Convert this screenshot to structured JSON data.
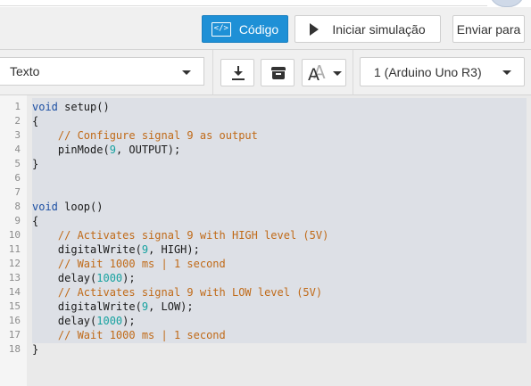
{
  "toolbar": {
    "code_label": "Código",
    "simulate_label": "Iniciar simulação",
    "send_label": "Enviar para"
  },
  "editor_toolbar": {
    "mode_value": "Texto",
    "board_value": "1 (Arduino Uno R3)"
  },
  "icons": {
    "code": "code-icon",
    "play": "play-icon",
    "download": "download-icon",
    "library": "library-box-icon",
    "font": "font-size-icon"
  },
  "colors": {
    "accent": "#1e90d6",
    "keyword": "#1c4fa3",
    "comment": "#c06a18",
    "number": "#17a2a0"
  },
  "code": {
    "line_numbers": [
      "1",
      "2",
      "3",
      "4",
      "5",
      "6",
      "7",
      "8",
      "9",
      "10",
      "11",
      "12",
      "13",
      "14",
      "15",
      "16",
      "17",
      "18"
    ],
    "lines": [
      [
        {
          "t": "void",
          "c": "kw"
        },
        {
          "t": " setup()",
          "c": "fn"
        }
      ],
      [
        {
          "t": "{",
          "c": "fn"
        }
      ],
      [
        {
          "t": "    // Configure signal 9 as output",
          "c": "cm"
        }
      ],
      [
        {
          "t": "    pinMode(",
          "c": "fn"
        },
        {
          "t": "9",
          "c": "num"
        },
        {
          "t": ", OUTPUT);",
          "c": "fn"
        }
      ],
      [
        {
          "t": "}",
          "c": "fn"
        }
      ],
      [],
      [],
      [
        {
          "t": "void",
          "c": "kw"
        },
        {
          "t": " loop()",
          "c": "fn"
        }
      ],
      [
        {
          "t": "{",
          "c": "fn"
        }
      ],
      [
        {
          "t": "    // Activates signal 9 with HIGH level (5V)",
          "c": "cm"
        }
      ],
      [
        {
          "t": "    digitalWrite(",
          "c": "fn"
        },
        {
          "t": "9",
          "c": "num"
        },
        {
          "t": ", HIGH);",
          "c": "fn"
        }
      ],
      [
        {
          "t": "    // Wait 1000 ms | 1 second",
          "c": "cm"
        }
      ],
      [
        {
          "t": "    delay(",
          "c": "fn"
        },
        {
          "t": "1000",
          "c": "num"
        },
        {
          "t": ");",
          "c": "fn"
        }
      ],
      [
        {
          "t": "    // Activates signal 9 with LOW level (5V)",
          "c": "cm"
        }
      ],
      [
        {
          "t": "    digitalWrite(",
          "c": "fn"
        },
        {
          "t": "9",
          "c": "num"
        },
        {
          "t": ", LOW);",
          "c": "fn"
        }
      ],
      [
        {
          "t": "    delay(",
          "c": "fn"
        },
        {
          "t": "1000",
          "c": "num"
        },
        {
          "t": ");",
          "c": "fn"
        }
      ],
      [
        {
          "t": "    // Wait 1000 ms | 1 second",
          "c": "cm"
        }
      ],
      [
        {
          "t": "}",
          "c": "fn"
        }
      ]
    ]
  }
}
